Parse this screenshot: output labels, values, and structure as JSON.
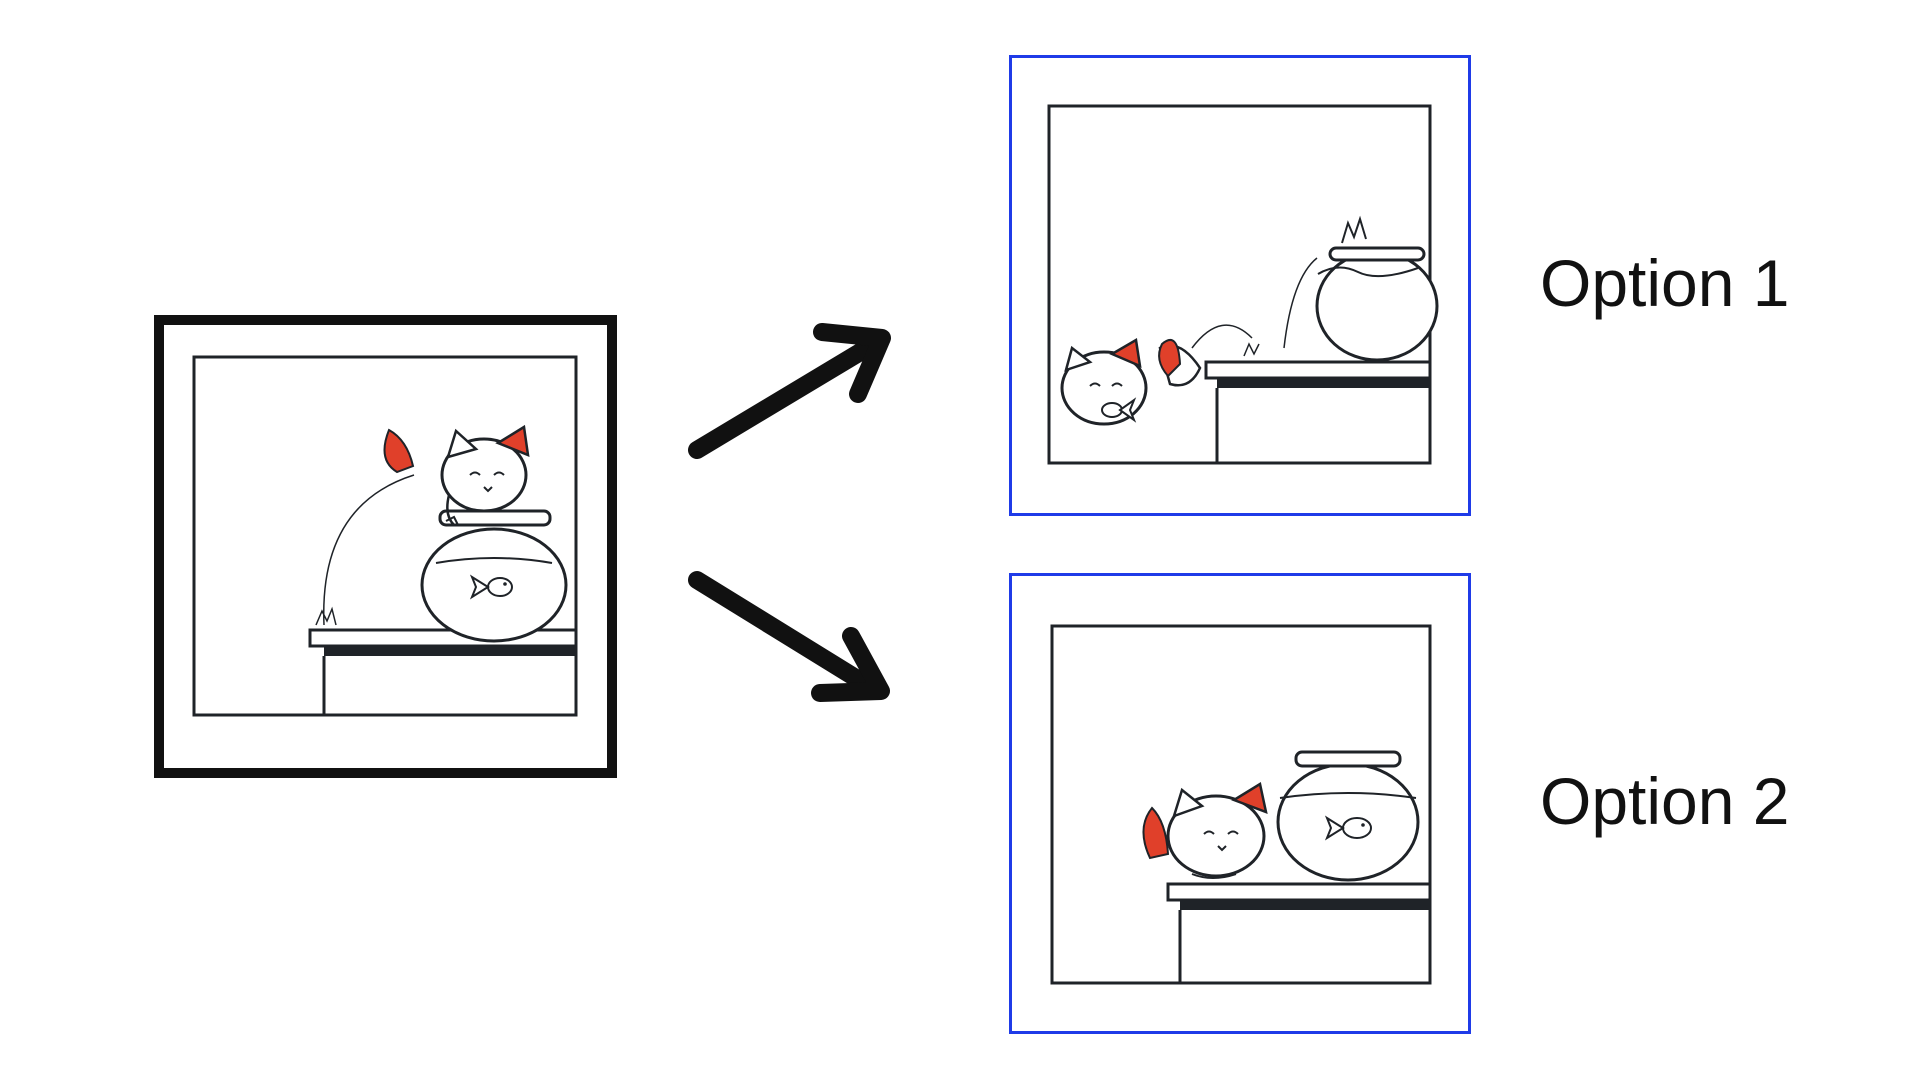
{
  "options": [
    {
      "label": "Option 1"
    },
    {
      "label": "Option 2"
    }
  ],
  "colors": {
    "option_border": "#1f3be8",
    "source_border": "#111111",
    "cat_accent": "#e0402a",
    "ink": "#1f2328"
  },
  "icons": {
    "arrow_up": "arrow-up-right-icon",
    "arrow_down": "arrow-down-right-icon"
  }
}
